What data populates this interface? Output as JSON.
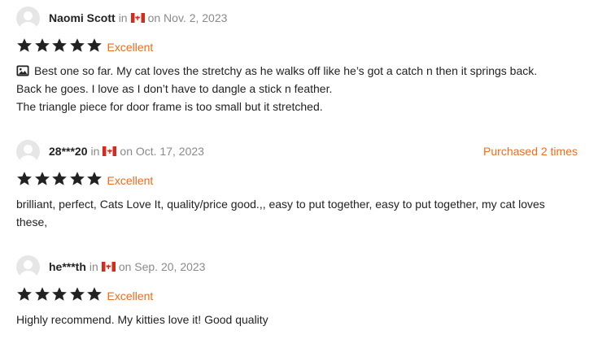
{
  "reviews": [
    {
      "name": "Naomi Scott",
      "in_text": "in",
      "date": "on Nov. 2, 2023",
      "purchased": "",
      "rating_label": "Excellent",
      "has_photo_icon": true,
      "lines": [
        "Best one so far. My cat loves the stretchy as he walks off like he’s got a catch n then it springs back.",
        "Back he goes. I love as I don’t have to dangle a stick n feather.",
        "The triangle piece for door frame is too small but it stretched."
      ]
    },
    {
      "name": "28***20",
      "in_text": "in",
      "date": "on Oct. 17, 2023",
      "purchased": "Purchased 2 times",
      "rating_label": "Excellent",
      "lines": [
        "brilliant, perfect, Cats Love It, quality/price good.,, easy to put together, easy to put together, my cat loves",
        "these,"
      ]
    },
    {
      "name": "he***th",
      "in_text": "in",
      "date": "on Sep. 20, 2023",
      "purchased": "",
      "rating_label": "Excellent",
      "lines": [
        "Highly recommend. My kitties love it! Good quality"
      ]
    }
  ],
  "rating_stars": 5,
  "colors": {
    "accent": "#f26b1d",
    "meta_text": "#8a8a8a",
    "star": "#222222",
    "flag_red": "#d52b1e"
  },
  "icons": {
    "avatar": "user-avatar-icon",
    "flag": "canada-flag-icon",
    "star": "star-icon",
    "photo": "photo-icon"
  }
}
